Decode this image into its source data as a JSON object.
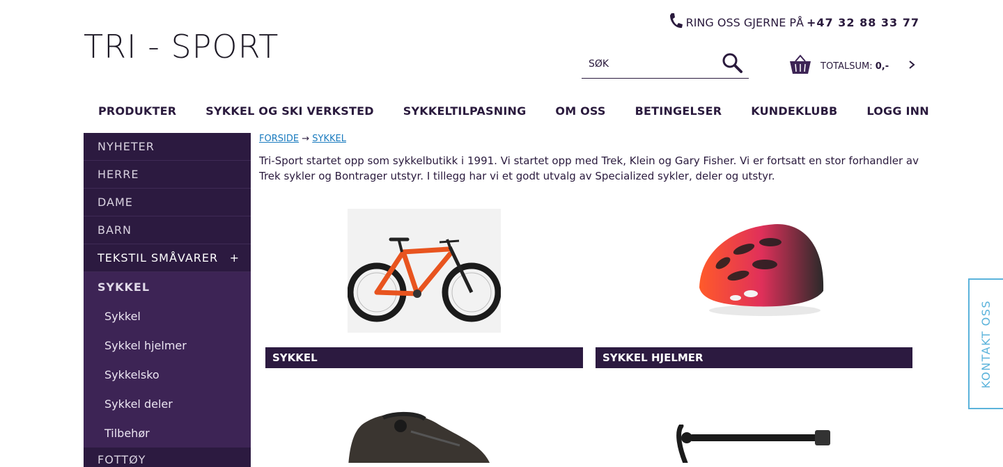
{
  "header": {
    "logo": "TRI - SPORT",
    "phone_prefix": "RING OSS GJERNE PÅ",
    "phone_number": "+47 32 88 33 77",
    "search_placeholder": "SØK",
    "cart_label": "TOTALSUM:",
    "cart_sum": "0,-"
  },
  "nav": [
    "PRODUKTER",
    "SYKKEL OG SKI VERKSTED",
    "SYKKELTILPASNING",
    "OM OSS",
    "BETINGELSER",
    "KUNDEKLUBB",
    "LOGG INN"
  ],
  "sidebar": {
    "items": [
      "NYHETER",
      "HERRE",
      "DAME",
      "BARN"
    ],
    "expandable": {
      "label": "TEKSTIL SMÅVARER",
      "toggle": "+"
    },
    "active": "SYKKEL",
    "subitems": [
      "Sykkel",
      "Sykkel hjelmer",
      "Sykkelsko",
      "Sykkel deler",
      "Tilbehør"
    ],
    "after": "FOTTØY"
  },
  "breadcrumb": {
    "home": "FORSIDE",
    "arrow": "→",
    "current": "SYKKEL"
  },
  "intro": "Tri-Sport startet opp som sykkelbutikk i 1991. Vi startet opp med Trek, Klein og Gary Fisher. Vi er fortsatt en stor forhandler av Trek sykler og Bontrager utstyr. I tillegg har vi et godt utvalg av Specialized sykler, deler og utstyr.",
  "products": [
    {
      "label": "SYKKEL"
    },
    {
      "label": "SYKKEL HJELMER"
    }
  ],
  "contact_tab": "KONTAKT OSS",
  "colors": {
    "sidebar": "#3d2455",
    "sidebar_dark": "#2c1a40",
    "accent": "#5bb3db",
    "link": "#1a7bbf"
  }
}
